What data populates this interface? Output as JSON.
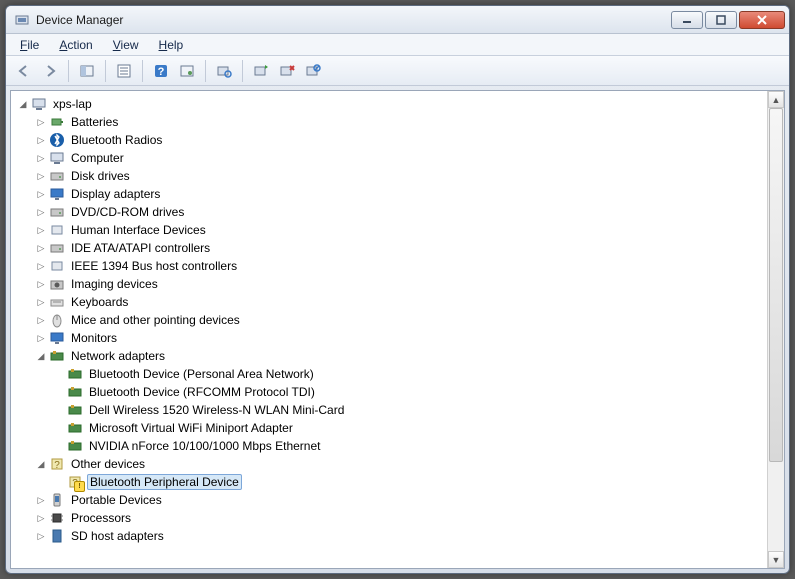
{
  "window": {
    "title": "Device Manager"
  },
  "menubar": {
    "file": "File",
    "action": "Action",
    "view": "View",
    "help": "Help"
  },
  "toolbar": {
    "back": "back-icon",
    "forward": "forward-icon",
    "show_hide": "show-hide-tree-icon",
    "properties": "properties-icon",
    "help": "help-icon",
    "action": "action-icon",
    "scan": "scan-hardware-icon",
    "update": "update-driver-icon",
    "uninstall": "uninstall-icon",
    "disable": "disable-icon"
  },
  "tree": {
    "root": "xps-lap",
    "categories": [
      {
        "label": "Batteries",
        "icon": "battery-icon"
      },
      {
        "label": "Bluetooth Radios",
        "icon": "bluetooth-icon"
      },
      {
        "label": "Computer",
        "icon": "computer-icon"
      },
      {
        "label": "Disk drives",
        "icon": "disk-icon"
      },
      {
        "label": "Display adapters",
        "icon": "display-icon"
      },
      {
        "label": "DVD/CD-ROM drives",
        "icon": "optical-icon"
      },
      {
        "label": "Human Interface Devices",
        "icon": "hid-icon"
      },
      {
        "label": "IDE ATA/ATAPI controllers",
        "icon": "ide-icon"
      },
      {
        "label": "IEEE 1394 Bus host controllers",
        "icon": "firewire-icon"
      },
      {
        "label": "Imaging devices",
        "icon": "camera-icon"
      },
      {
        "label": "Keyboards",
        "icon": "keyboard-icon"
      },
      {
        "label": "Mice and other pointing devices",
        "icon": "mouse-icon"
      },
      {
        "label": "Monitors",
        "icon": "monitor-icon"
      }
    ],
    "network": {
      "label": "Network adapters",
      "icon": "network-icon",
      "children": [
        "Bluetooth Device (Personal Area Network)",
        "Bluetooth Device (RFCOMM Protocol TDI)",
        "Dell Wireless 1520 Wireless-N WLAN Mini-Card",
        "Microsoft Virtual WiFi Miniport Adapter",
        "NVIDIA nForce 10/100/1000 Mbps Ethernet"
      ]
    },
    "other": {
      "label": "Other devices",
      "icon": "other-icon",
      "children": [
        {
          "label": "Bluetooth Peripheral Device",
          "warn": true,
          "selected": true
        }
      ]
    },
    "tail": [
      {
        "label": "Portable Devices",
        "icon": "portable-icon"
      },
      {
        "label": "Processors",
        "icon": "processor-icon"
      },
      {
        "label": "SD host adapters",
        "icon": "sd-icon"
      }
    ]
  }
}
